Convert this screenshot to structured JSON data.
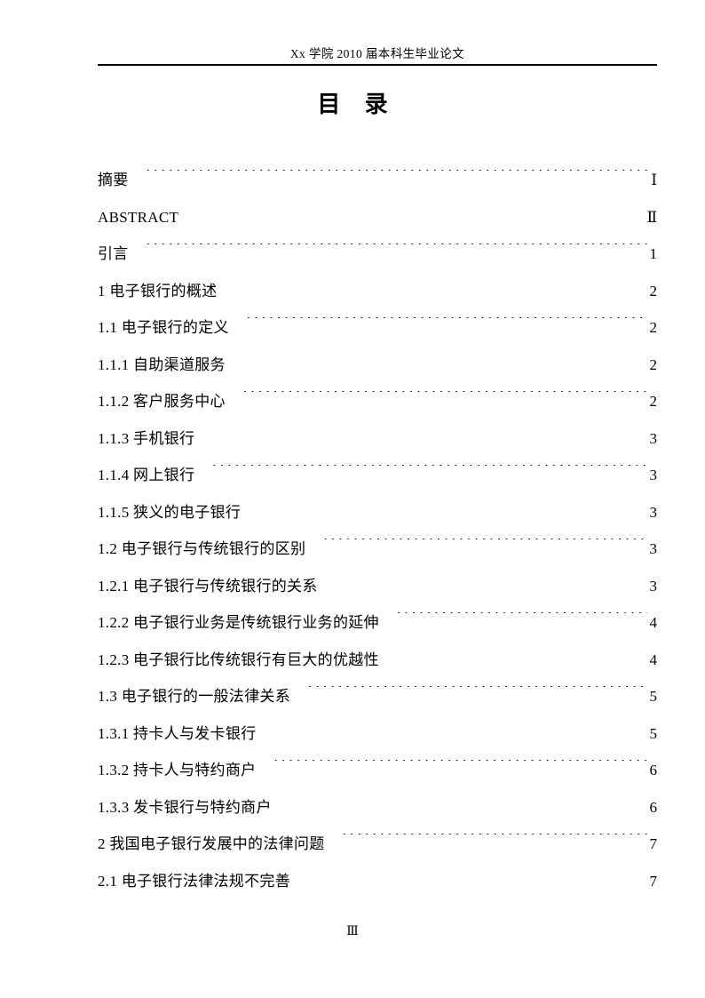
{
  "page": {
    "running_header": "Xx 学院 2010 届本科生毕业论文",
    "title": "目  录",
    "footer_page_number": "Ⅲ"
  },
  "toc": {
    "entries": [
      {
        "label": "摘要",
        "page": "Ⅰ"
      },
      {
        "label": "ABSTRACT",
        "page": "Ⅱ"
      },
      {
        "label": "引言",
        "page": "1"
      },
      {
        "label": "1  电子银行的概述",
        "page": "2"
      },
      {
        "label": "1.1 电子银行的定义",
        "page": "2"
      },
      {
        "label": "1.1.1  自助渠道服务",
        "page": "2"
      },
      {
        "label": "1.1.2 客户服务中心",
        "page": "2"
      },
      {
        "label": "1.1.3  手机银行",
        "page": "3"
      },
      {
        "label": "1.1.4  网上银行",
        "page": "3"
      },
      {
        "label": "1.1.5  狭义的电子银行",
        "page": "3"
      },
      {
        "label": "1.2  电子银行与传统银行的区别",
        "page": "3"
      },
      {
        "label": "1.2.1 电子银行与传统银行的关系",
        "page": "3"
      },
      {
        "label": "1.2.2 电子银行业务是传统银行业务的延伸",
        "page": "4"
      },
      {
        "label": "1.2.3 电子银行比传统银行有巨大的优越性",
        "page": "4"
      },
      {
        "label": "1.3  电子银行的一般法律关系",
        "page": "5"
      },
      {
        "label": "1.3.1  持卡人与发卡银行",
        "page": "5"
      },
      {
        "label": "1.3.2  持卡人与特约商户",
        "page": "6"
      },
      {
        "label": "1.3.3  发卡银行与特约商户",
        "page": "6"
      },
      {
        "label": "2   我国电子银行发展中的法律问题",
        "page": "7"
      },
      {
        "label": "2.1  电子银行法律法规不完善",
        "page": "7"
      }
    ]
  }
}
